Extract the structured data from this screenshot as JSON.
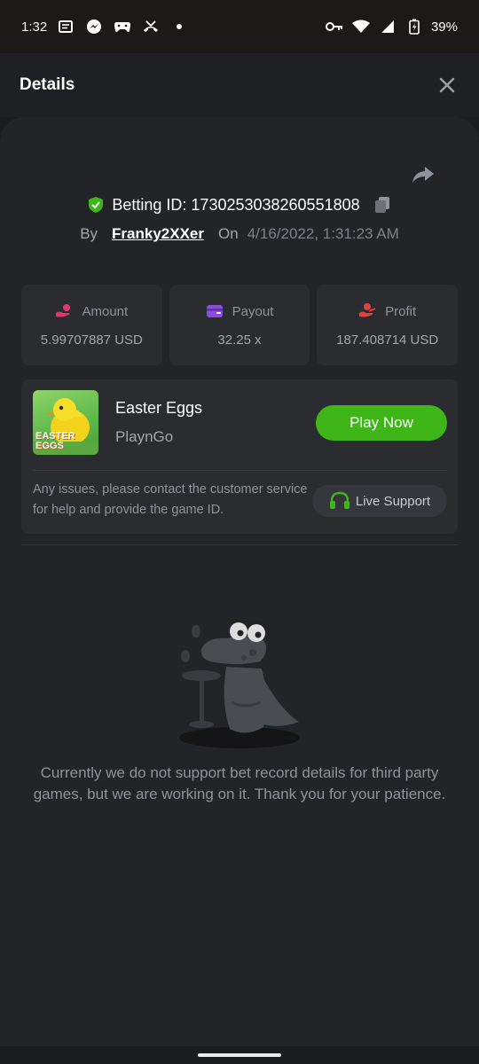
{
  "status_bar": {
    "time": "1:32",
    "battery": "39%",
    "left_icons": [
      "notes-icon",
      "messenger-icon",
      "gamepad-icon",
      "missed-call-icon",
      "dot-icon"
    ],
    "right_icons": [
      "vpn-key-icon",
      "wifi-icon",
      "signal-icon",
      "battery-icon"
    ]
  },
  "header": {
    "title": "Details",
    "close_icon": "close-icon"
  },
  "bet": {
    "betting_id": "Betting ID: 1730253038260551808",
    "by_label": "By",
    "username": "Franky2XXer",
    "on_label": "On",
    "date": "4/16/2022, 1:31:23 AM"
  },
  "stats": [
    {
      "label": "Amount",
      "value": "5.99707887 USD",
      "icon": "coins-hand-icon",
      "color": "#e0356f"
    },
    {
      "label": "Payout",
      "value": "32.25 x",
      "icon": "wallet-icon",
      "color": "#8b4dde"
    },
    {
      "label": "Profit",
      "value": "187.408714 USD",
      "icon": "profit-hand-icon",
      "color": "#e04040"
    }
  ],
  "game": {
    "name": "Easter Eggs",
    "provider": "PlaynGo",
    "thumb_text": "EASTER EGGS",
    "play_label": "Play Now",
    "issue_text": "Any issues, please contact the customer service for help and provide the game ID.",
    "support_label": "Live Support"
  },
  "empty_state": {
    "message": "Currently we do not support bet record details for third party games, but we are working on it. Thank you for your patience."
  },
  "colors": {
    "accent_green": "#3fb618",
    "background": "#1b1c1f",
    "panel": "#232427",
    "card": "#2b2c30"
  }
}
